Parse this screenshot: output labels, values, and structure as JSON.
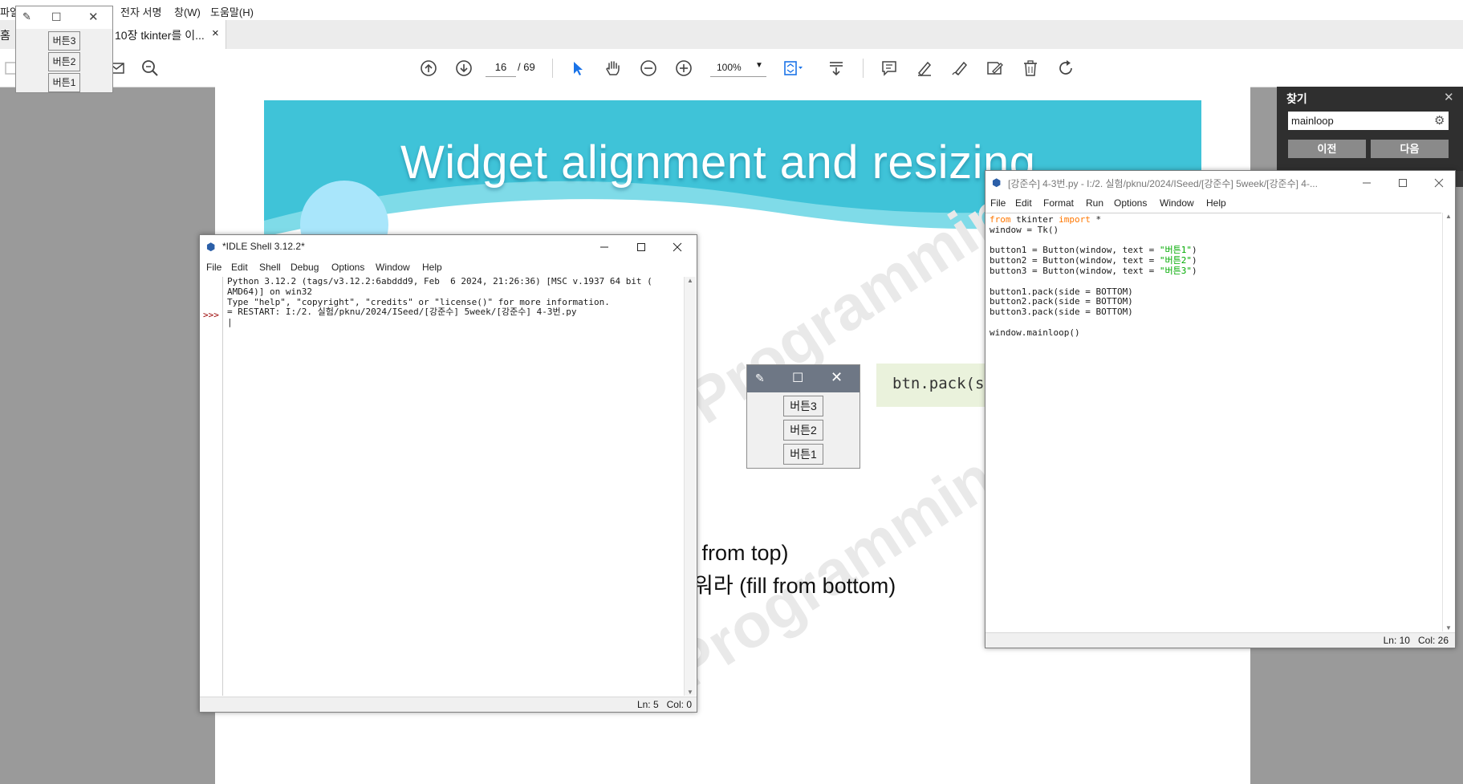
{
  "menubar": {
    "items": [
      "파일",
      "전자 서명",
      "창(W)",
      "도움말(H)"
    ]
  },
  "tabs": {
    "home": "홈",
    "doc_tab": "10장 tkinter를 이...",
    "close_glyph": "×"
  },
  "toolbar": {
    "current_page": "16",
    "page_sep": "/ 69",
    "zoom": "100%"
  },
  "slide": {
    "title": "Widget alignment and resizing",
    "code": "btn.pack(sid",
    "line1": "ll from top)",
    "line2": "워라 (fill from bottom)",
    "watermark": "Programming"
  },
  "tk_demo": {
    "buttons": [
      "버튼3",
      "버튼2",
      "버튼1"
    ]
  },
  "tk_small": {
    "buttons": [
      "버튼3",
      "버튼2",
      "버튼1"
    ]
  },
  "find": {
    "title": "찾기",
    "query": "mainloop",
    "prev": "이전",
    "next": "다음"
  },
  "shell": {
    "title": "*IDLE Shell 3.12.2*",
    "menus": [
      "File",
      "Edit",
      "Shell",
      "Debug",
      "Options",
      "Window",
      "Help"
    ],
    "prompt": ">>>",
    "lines": [
      "Python 3.12.2 (tags/v3.12.2:6abddd9, Feb  6 2024, 21:26:36) [MSC v.1937 64 bit (",
      "AMD64)] on win32",
      "Type \"help\", \"copyright\", \"credits\" or \"license()\" for more information.",
      "",
      "= RESTART: I:/2. 실험/pknu/2024/ISeed/[강준수] 5week/[강준수] 4-3번.py",
      "|"
    ],
    "status": "Ln: 5   Col: 0"
  },
  "editor": {
    "title": "[강준수] 4-3번.py - I:/2. 실험/pknu/2024/ISeed/[강준수] 5week/[강준수] 4-...",
    "menus": [
      "File",
      "Edit",
      "Format",
      "Run",
      "Options",
      "Window",
      "Help"
    ],
    "code": {
      "l1_kw1": "from",
      "l1_mid": " tkinter ",
      "l1_kw2": "import",
      "l1_end": " *",
      "l2": "window = Tk()",
      "b1_pre": "button1 = Button(window, text = ",
      "b1_str": "\"버튼1\"",
      "b1_end": ")",
      "b2_pre": "button2 = Button(window, text = ",
      "b2_str": "\"버튼2\"",
      "b2_end": ")",
      "b3_pre": "button3 = Button(window, text = ",
      "b3_str": "\"버튼3\"",
      "b3_end": ")",
      "p1": "button1.pack(side = BOTTOM)",
      "p2": "button2.pack(side = BOTTOM)",
      "p3": "button3.pack(side = BOTTOM)",
      "ml": "window.mainloop()"
    },
    "status": "Ln: 10   Col: 26"
  },
  "colors": {
    "banner": "#3fc3d8",
    "keyword": "#ff7700",
    "string": "#00aa00",
    "prompt": "#990000"
  }
}
